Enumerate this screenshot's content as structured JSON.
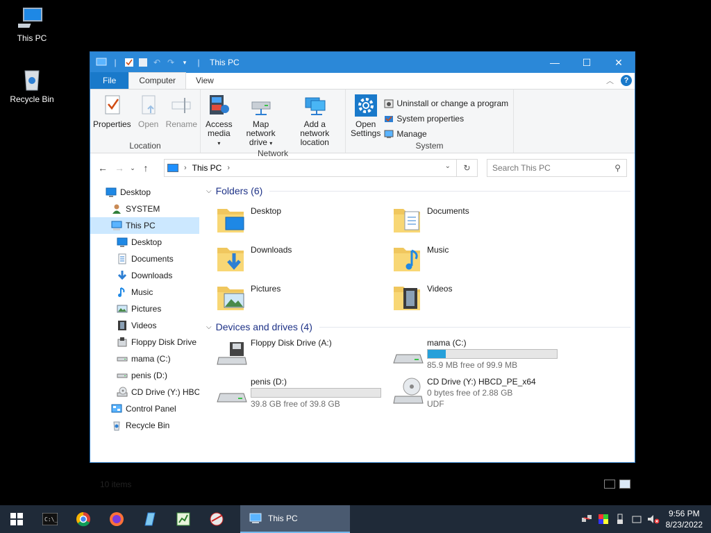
{
  "desktop": {
    "icons": [
      {
        "label": "This PC"
      },
      {
        "label": "Recycle Bin"
      }
    ]
  },
  "window": {
    "title": "This PC",
    "ribbon_tabs": [
      "File",
      "Computer",
      "View"
    ],
    "ribbon": {
      "location": {
        "name": "Location",
        "buttons": [
          "Properties",
          "Open",
          "Rename"
        ]
      },
      "network": {
        "name": "Network",
        "access_media": [
          "Access",
          "media"
        ],
        "map_drive": [
          "Map network",
          "drive"
        ],
        "add_location": [
          "Add a network",
          "location"
        ]
      },
      "system": {
        "name": "System",
        "open_settings": [
          "Open",
          "Settings"
        ],
        "uninstall": "Uninstall or change a program",
        "sys_props": "System properties",
        "manage": "Manage"
      }
    },
    "address": {
      "path": "This PC",
      "search_placeholder": "Search This PC"
    },
    "nav": [
      {
        "label": "Desktop",
        "indent": 0,
        "icon": "desktop-icon"
      },
      {
        "label": "SYSTEM",
        "indent": 1,
        "icon": "user-icon"
      },
      {
        "label": "This PC",
        "indent": 1,
        "icon": "this-pc-icon",
        "selected": true
      },
      {
        "label": "Desktop",
        "indent": 2,
        "icon": "desktop-icon"
      },
      {
        "label": "Documents",
        "indent": 2,
        "icon": "documents-icon"
      },
      {
        "label": "Downloads",
        "indent": 2,
        "icon": "downloads-icon"
      },
      {
        "label": "Music",
        "indent": 2,
        "icon": "music-icon"
      },
      {
        "label": "Pictures",
        "indent": 2,
        "icon": "pictures-icon"
      },
      {
        "label": "Videos",
        "indent": 2,
        "icon": "videos-icon"
      },
      {
        "label": "Floppy Disk Drive",
        "indent": 2,
        "icon": "floppy-icon"
      },
      {
        "label": "mama (C:)",
        "indent": 2,
        "icon": "drive-icon"
      },
      {
        "label": "penis (D:)",
        "indent": 2,
        "icon": "drive-icon"
      },
      {
        "label": "CD Drive (Y:) HBC",
        "indent": 2,
        "icon": "cd-drive-icon"
      },
      {
        "label": "Control Panel",
        "indent": 1,
        "icon": "control-panel-icon"
      },
      {
        "label": "Recycle Bin",
        "indent": 1,
        "icon": "recycle-bin-icon"
      }
    ],
    "folders_header": "Folders (6)",
    "folders": [
      {
        "label": "Desktop",
        "icon": "folder-desktop-icon"
      },
      {
        "label": "Documents",
        "icon": "folder-documents-icon"
      },
      {
        "label": "Downloads",
        "icon": "folder-downloads-icon"
      },
      {
        "label": "Music",
        "icon": "folder-music-icon"
      },
      {
        "label": "Pictures",
        "icon": "folder-pictures-icon"
      },
      {
        "label": "Videos",
        "icon": "folder-videos-icon"
      }
    ],
    "drives_header": "Devices and drives (4)",
    "drives": [
      {
        "label": "Floppy Disk Drive (A:)",
        "icon": "floppy-drive-icon",
        "bar": false
      },
      {
        "label": "mama (C:)",
        "icon": "hard-drive-icon",
        "bar": true,
        "used_fraction": 0.14,
        "free": "85.9 MB free of 99.9 MB"
      },
      {
        "label": "penis (D:)",
        "icon": "hard-drive-icon",
        "bar": true,
        "used_fraction": 0.0,
        "free": "39.8 GB free of 39.8 GB"
      },
      {
        "label": "CD Drive (Y:) HBCD_PE_x64",
        "icon": "cd-drive-icon",
        "bar": false,
        "free": "0 bytes free of 2.88 GB",
        "fs": "UDF"
      }
    ],
    "status": "10 items"
  },
  "taskbar": {
    "active_window": "This PC",
    "time": "9:56 PM",
    "date": "8/23/2022"
  },
  "colors": {
    "titlebar": "#2b88d8",
    "accent": "#1979ca",
    "taskbar": "#1f2a38",
    "selection": "#cce8ff",
    "progress": "#26a0da"
  }
}
